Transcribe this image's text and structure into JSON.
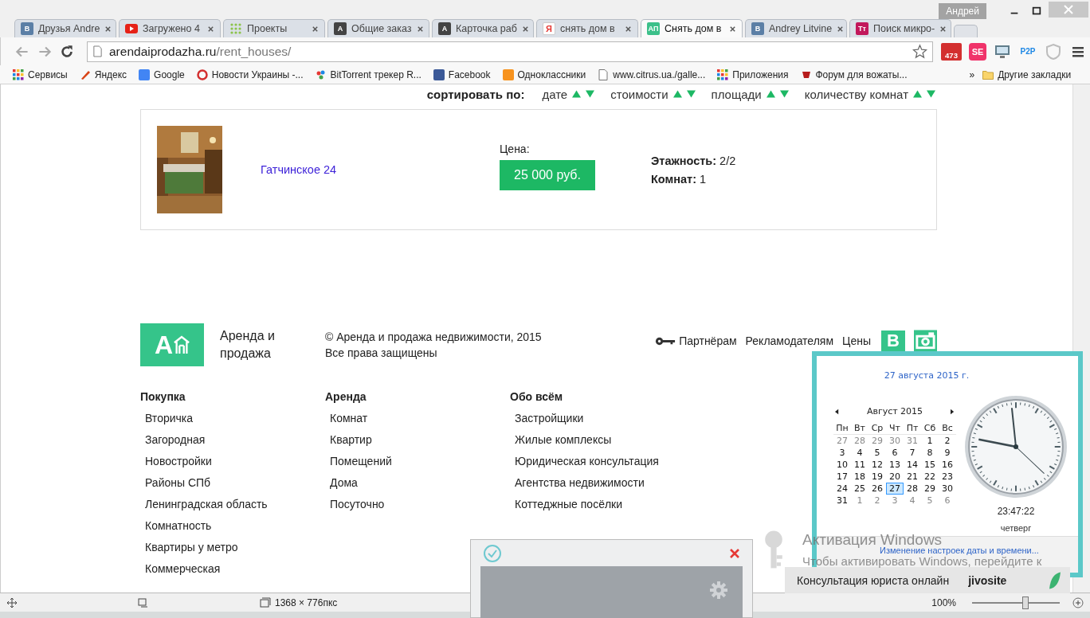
{
  "window": {
    "profile": "Андрей"
  },
  "tabs": [
    {
      "label": "Друзья Andre",
      "selected": false,
      "icon": {
        "kind": "letter",
        "text": "В",
        "color": "#5b7fa6"
      }
    },
    {
      "label": "Загружено 4",
      "selected": false,
      "icon": {
        "kind": "play",
        "color": "#e62117"
      }
    },
    {
      "label": "Проекты",
      "selected": false,
      "icon": {
        "kind": "dots",
        "color": "#8bc34a"
      }
    },
    {
      "label": "Общие заказ",
      "selected": false,
      "icon": {
        "kind": "letter",
        "text": "A",
        "color": "#444444"
      }
    },
    {
      "label": "Карточка раб",
      "selected": false,
      "icon": {
        "kind": "letter",
        "text": "A",
        "color": "#444444"
      }
    },
    {
      "label": "снять дом в",
      "selected": false,
      "icon": {
        "kind": "outlined",
        "text": "Я",
        "color": "#e53935"
      }
    },
    {
      "label": "Снять дом в",
      "selected": true,
      "icon": {
        "kind": "letter",
        "text": "АП",
        "color": "#3cc08a"
      }
    },
    {
      "label": "Andrey Litvine",
      "selected": false,
      "icon": {
        "kind": "letter",
        "text": "В",
        "color": "#5b7fa6"
      }
    },
    {
      "label": "Поиск микро-",
      "selected": false,
      "icon": {
        "kind": "letter",
        "text": "Тт",
        "color": "#c2185b"
      }
    }
  ],
  "address": {
    "host": "arendaiprodazha.ru",
    "path": "/rent_houses/"
  },
  "extensions": [
    {
      "kind": "mail",
      "text": "473",
      "color": "#d32f2f"
    },
    {
      "kind": "letter",
      "text": "SE",
      "color": "#f0336a"
    },
    {
      "kind": "screen",
      "color": "#607d8b"
    },
    {
      "kind": "plain",
      "text": "P2P",
      "color": "#1e88e5"
    },
    {
      "kind": "shield",
      "color": "#bdbdbd"
    }
  ],
  "bookmarks": [
    {
      "label": "Сервисы",
      "kind": "grid"
    },
    {
      "label": "Яндекс",
      "kind": "pen"
    },
    {
      "label": "Google",
      "kind": "blue"
    },
    {
      "label": "Новости Украины -...",
      "kind": "ring"
    },
    {
      "label": "BitTorrent трекер R...",
      "kind": "cluster"
    },
    {
      "label": "Facebook",
      "kind": "navy"
    },
    {
      "label": "Одноклассники",
      "kind": "orange"
    },
    {
      "label": "www.citrus.ua./galle...",
      "kind": "page"
    },
    {
      "label": "Приложения",
      "kind": "grid"
    },
    {
      "label": "Форум для вожаты...",
      "kind": "cup"
    }
  ],
  "bookmarks_more": "»",
  "other_bookmarks": "Другие закладки",
  "sort": {
    "label": "сортировать по:",
    "options": [
      "дате",
      "стоимости",
      "площади",
      "количеству комнат"
    ]
  },
  "listing": {
    "title": "Гатчинское 24",
    "price_label": "Цена:",
    "price": "25 000 руб.",
    "details": [
      "**Этажность:** 2/2",
      "**Комнат:** 1"
    ]
  },
  "footer": {
    "logo_mark": "А",
    "brand": "Аренда и продажа",
    "copyright": "© Аренда и продажа недвижимости, 2015",
    "rights": "Все права защищены",
    "links": [
      "Партнёрам",
      "Рекламодателям",
      "Цены"
    ],
    "vk": "В",
    "columns": [
      {
        "title": "Покупка",
        "links": [
          "Вторичка",
          "Загородная",
          "Новостройки",
          "Районы СПб",
          "Ленинградская область",
          "Комнатность",
          "Квартиры у метро",
          "Коммерческая"
        ]
      },
      {
        "title": "Аренда",
        "links": [
          "Комнат",
          "Квартир",
          "Помещений",
          "Дома",
          "Посуточно"
        ]
      },
      {
        "title": "Обо всём",
        "links": [
          "Застройщики",
          "Жилые комплексы",
          "Юридическая консультация",
          "Агентства недвижимости",
          "Коттеджные посёлки"
        ]
      }
    ]
  },
  "clock_popup": {
    "date_link": "27 августа 2015 г.",
    "month": "Август 2015",
    "weekdays": [
      "Пн",
      "Вт",
      "Ср",
      "Чт",
      "Пт",
      "Сб",
      "Вс"
    ],
    "weeks": [
      [
        {
          "d": "27",
          "muted": true,
          "selected": false
        },
        {
          "d": "28",
          "muted": true,
          "selected": false
        },
        {
          "d": "29",
          "muted": true,
          "selected": false
        },
        {
          "d": "30",
          "muted": true,
          "selected": false
        },
        {
          "d": "31",
          "muted": true,
          "selected": false
        },
        {
          "d": "1",
          "muted": false,
          "selected": false
        },
        {
          "d": "2",
          "muted": false,
          "selected": false
        }
      ],
      [
        {
          "d": "3",
          "muted": false,
          "selected": false
        },
        {
          "d": "4",
          "muted": false,
          "selected": false
        },
        {
          "d": "5",
          "muted": false,
          "selected": false
        },
        {
          "d": "6",
          "muted": false,
          "selected": false
        },
        {
          "d": "7",
          "muted": false,
          "selected": false
        },
        {
          "d": "8",
          "muted": false,
          "selected": false
        },
        {
          "d": "9",
          "muted": false,
          "selected": false
        }
      ],
      [
        {
          "d": "10",
          "muted": false,
          "selected": false
        },
        {
          "d": "11",
          "muted": false,
          "selected": false
        },
        {
          "d": "12",
          "muted": false,
          "selected": false
        },
        {
          "d": "13",
          "muted": false,
          "selected": false
        },
        {
          "d": "14",
          "muted": false,
          "selected": false
        },
        {
          "d": "15",
          "muted": false,
          "selected": false
        },
        {
          "d": "16",
          "muted": false,
          "selected": false
        }
      ],
      [
        {
          "d": "17",
          "muted": false,
          "selected": false
        },
        {
          "d": "18",
          "muted": false,
          "selected": false
        },
        {
          "d": "19",
          "muted": false,
          "selected": false
        },
        {
          "d": "20",
          "muted": false,
          "selected": false
        },
        {
          "d": "21",
          "muted": false,
          "selected": false
        },
        {
          "d": "22",
          "muted": false,
          "selected": false
        },
        {
          "d": "23",
          "muted": false,
          "selected": false
        }
      ],
      [
        {
          "d": "24",
          "muted": false,
          "selected": false
        },
        {
          "d": "25",
          "muted": false,
          "selected": false
        },
        {
          "d": "26",
          "muted": false,
          "selected": false
        },
        {
          "d": "27",
          "muted": false,
          "selected": true
        },
        {
          "d": "28",
          "muted": false,
          "selected": false
        },
        {
          "d": "29",
          "muted": false,
          "selected": false
        },
        {
          "d": "30",
          "muted": false,
          "selected": false
        }
      ],
      [
        {
          "d": "31",
          "muted": false,
          "selected": false
        },
        {
          "d": "1",
          "muted": true,
          "selected": false
        },
        {
          "d": "2",
          "muted": true,
          "selected": false
        },
        {
          "d": "3",
          "muted": true,
          "selected": false
        },
        {
          "d": "4",
          "muted": true,
          "selected": false
        },
        {
          "d": "5",
          "muted": true,
          "selected": false
        },
        {
          "d": "6",
          "muted": true,
          "selected": false
        }
      ]
    ],
    "time": "23:47:22",
    "weekday": "четверг",
    "settings_link": "Изменение настроек даты и времени..."
  },
  "activation": {
    "title": "Активация Windows",
    "text": "Чтобы активировать Windows, перейдите к"
  },
  "chat": {
    "label": "Консультация юриста онлайн",
    "brand": "jivosite"
  },
  "status_bar": {
    "dimensions": "1368 × 776пкс",
    "zoom": "100%",
    "zoom_slider": {
      "level": 0.6
    }
  }
}
